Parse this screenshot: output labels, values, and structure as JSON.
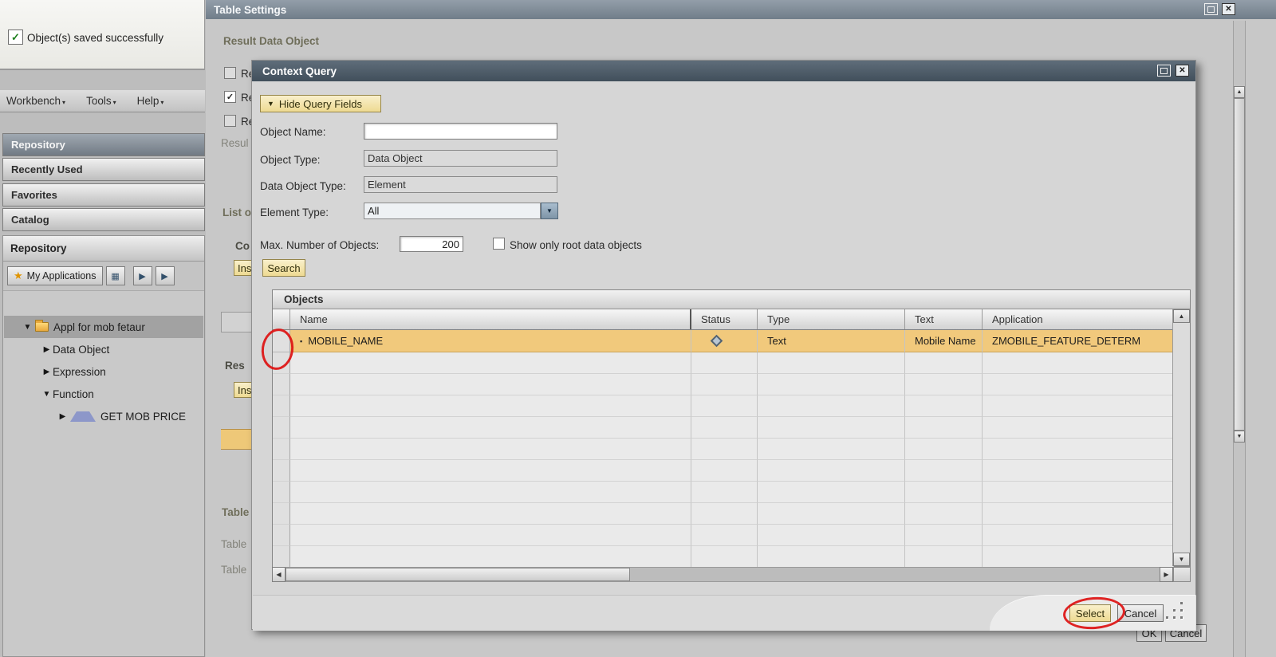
{
  "icons": {
    "menu_caret": "▾",
    "collapse": "▼",
    "dropdown_arrow": "▼",
    "star": "★",
    "check": "✓",
    "bullet": "▪",
    "close": "✕",
    "scroll_up": "▲",
    "scroll_down": "▼",
    "scroll_left": "◀",
    "scroll_right": "▶",
    "expander_open": "▼",
    "expander_closed": "▶",
    "forward": "▶",
    "grid": "▦"
  },
  "notification": {
    "message": "Object(s) saved successfully"
  },
  "menu": {
    "items": [
      {
        "label": "Workbench"
      },
      {
        "label": "Tools"
      },
      {
        "label": "Help"
      }
    ]
  },
  "sidebar": {
    "nav_items": [
      {
        "label": "Repository"
      },
      {
        "label": "Recently Used"
      },
      {
        "label": "Favorites"
      },
      {
        "label": "Catalog"
      }
    ],
    "panel_title": "Repository",
    "my_applications_button": "My Applications",
    "tree": [
      {
        "label": "Appl for mob fetaur",
        "selected": true
      },
      {
        "label": "Data Object"
      },
      {
        "label": "Expression"
      },
      {
        "label": "Function"
      },
      {
        "label": "GET MOB PRICE"
      }
    ]
  },
  "table_settings": {
    "title": "Table Settings",
    "result_section_label": "Result Data Object",
    "checkbox_rows": [
      {
        "label": "Re",
        "checked": false
      },
      {
        "label": "Re",
        "checked": true
      },
      {
        "label": "Re",
        "checked": false
      }
    ],
    "result_partial": "Resul",
    "list_section_label": "List o",
    "co_partial": "Co",
    "insert_button_partial": "Ins",
    "res_partial": "Res",
    "insert_button2_partial": "Ins",
    "table_section_label": "Table",
    "table_label_partial_1": "Table",
    "table_label_partial_2": "Table",
    "ok_button": "OK",
    "cancel_button": "Cancel"
  },
  "context_query": {
    "title": "Context Query",
    "hide_query_fields_button": "Hide Query Fields",
    "object_name_label": "Object Name:",
    "object_name_value": "",
    "object_type_label": "Object Type:",
    "object_type_value": "Data Object",
    "data_object_type_label": "Data Object Type:",
    "data_object_type_value": "Element",
    "element_type_label": "Element Type:",
    "element_type_value": "All",
    "max_objects_label": "Max. Number of Objects:",
    "max_objects_value": "200",
    "show_root_checkbox_label": "Show only root data objects",
    "show_root_checked": false,
    "search_button": "Search",
    "objects_panel_title": "Objects",
    "table": {
      "columns": [
        "Name",
        "Status",
        "Type",
        "Text",
        "Application"
      ],
      "rows": [
        {
          "name": "MOBILE_NAME",
          "status_icon": "diamond",
          "type": "Text",
          "text": "Mobile Name",
          "application": "ZMOBILE_FEATURE_DETERM",
          "selected": true
        }
      ],
      "empty_row_count": 10
    },
    "select_button": "Select",
    "cancel_button": "Cancel"
  }
}
